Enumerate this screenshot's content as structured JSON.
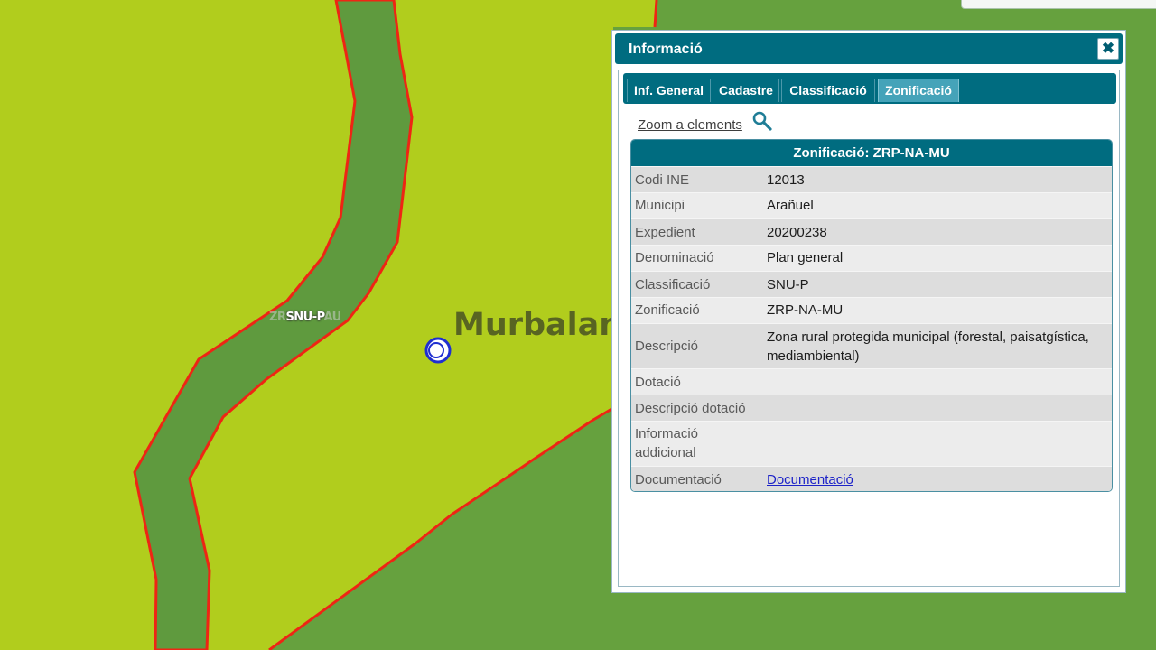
{
  "map": {
    "zone_label_faint_left": "ZR",
    "zone_label": "SNU-P",
    "zone_label_faint_right": "AU",
    "watermark": "Murbalands ®",
    "colors": {
      "land": "#b1cd1d",
      "corridor": "#5f9a3e",
      "border": "#ee2514",
      "marker": "#1f2fd0"
    }
  },
  "popup": {
    "title": "Informació",
    "close_icon": "close-icon",
    "tabs": [
      {
        "label": "Inf. General",
        "active": false
      },
      {
        "label": "Cadastre",
        "active": false
      },
      {
        "label": "Classificació",
        "active": false
      },
      {
        "label": "Zonificació",
        "active": true
      }
    ],
    "zoom_link": "Zoom a elements",
    "zoom_icon": "search-icon",
    "table": {
      "heading": "Zonificació: ZRP-NA-MU",
      "rows": [
        {
          "label": "Codi INE",
          "value": "12013"
        },
        {
          "label": "Municipi",
          "value": "Arañuel"
        },
        {
          "label": "Expedient",
          "value": "20200238"
        },
        {
          "label": "Denominació",
          "value": "Plan general"
        },
        {
          "label": "Classificació",
          "value": "SNU-P"
        },
        {
          "label": "Zonificació",
          "value": "ZRP-NA-MU"
        },
        {
          "label": "Descripció",
          "value": "Zona rural protegida municipal (forestal, paisatgística, mediambiental)"
        },
        {
          "label": "Dotació",
          "value": ""
        },
        {
          "label": "Descripció dotació",
          "value": ""
        },
        {
          "label": "Informació addicional",
          "value": ""
        },
        {
          "label": "Documentació",
          "value": "Documentació"
        }
      ]
    },
    "colors": {
      "header": "#006c80",
      "active_tab": "#45a3b9",
      "link": "#1d23c8"
    }
  }
}
